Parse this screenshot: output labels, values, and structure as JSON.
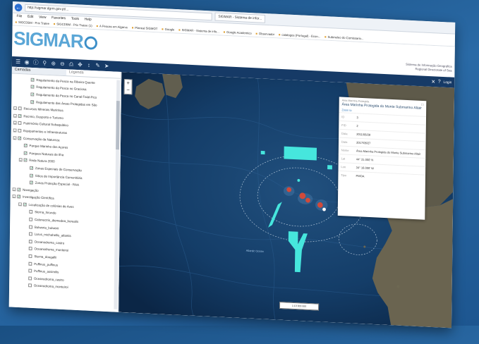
{
  "browser": {
    "url": "http://sigmar.dgrm.gov.pt/...",
    "tab_label": "SIGMAR - Sistema de infor...",
    "menu": [
      "File",
      "Edit",
      "View",
      "Favorites",
      "Tools",
      "Help"
    ],
    "favorites": [
      "SIGCDBM - Prix Tratee",
      "SIGCDBM - Prix Tratee (1)",
      "A Pescas em Algarve",
      "Planeal SIGMOT",
      "Google",
      "SIGMAR - Sistema de info...",
      "Google Academico",
      "Observador",
      "catalogos (Portugal) - Econ...",
      "Submeleo do Comissario..."
    ]
  },
  "header": {
    "logo_text": "SIGMAR",
    "subtitle_line1": "Sistema de Informação Geográfica",
    "subtitle_line2": "Regional Directorate of Sea"
  },
  "toolbar": {
    "login": "Login",
    "icons": [
      "layers-icon",
      "globe-icon",
      "info-icon",
      "search-icon",
      "zoom-in-icon",
      "zoom-out-icon",
      "print-icon",
      "pan-icon",
      "measure-icon",
      "draw-icon",
      "share-icon"
    ]
  },
  "sidebar": {
    "tabs": [
      "Camadas",
      "Legenda"
    ],
    "items": [
      {
        "label": "Regulamento da Pesca na Ribeira Quente",
        "indent": 2,
        "checked": true,
        "expandable": false
      },
      {
        "label": "Regulamento da Pesca no Graciosa",
        "indent": 2,
        "checked": true,
        "expandable": false
      },
      {
        "label": "Regulamento da Pesca no Canal Faial-Pico",
        "indent": 2,
        "checked": true,
        "expandable": false
      },
      {
        "label": "Regulamento das Áreas Protegidas em São",
        "indent": 2,
        "checked": true,
        "expandable": false
      },
      {
        "label": "Recursos Minerais Marinhos",
        "indent": 0,
        "checked": false,
        "expandable": true
      },
      {
        "label": "Recreio, Desporto e Turismo",
        "indent": 0,
        "checked": true,
        "expandable": true
      },
      {
        "label": "Património Cultural Subaquático",
        "indent": 0,
        "checked": false,
        "expandable": true
      },
      {
        "label": "Equipamentos e Infraestruturas",
        "indent": 0,
        "checked": false,
        "expandable": true
      },
      {
        "label": "Conservação da Natureza",
        "indent": 0,
        "checked": true,
        "expandable": true
      },
      {
        "label": "Parque Marinho dos Açores",
        "indent": 1,
        "checked": true,
        "expandable": false
      },
      {
        "label": "Parques Naturais de Ilha",
        "indent": 1,
        "checked": true,
        "expandable": false
      },
      {
        "label": "Rede Natura 2000",
        "indent": 1,
        "checked": true,
        "expandable": true
      },
      {
        "label": "Zonas Especiais de Conservação",
        "indent": 2,
        "checked": true,
        "expandable": false
      },
      {
        "label": "Sítios de Importância Comunitária",
        "indent": 2,
        "checked": true,
        "expandable": false
      },
      {
        "label": "Zonas Proteção Especial - RAA",
        "indent": 2,
        "checked": true,
        "expandable": false
      },
      {
        "label": "Navegação",
        "indent": 0,
        "checked": true,
        "expandable": true
      },
      {
        "label": "Investigação Científica",
        "indent": 0,
        "checked": true,
        "expandable": true
      },
      {
        "label": "Localização de colónias de Aves",
        "indent": 1,
        "checked": true,
        "expandable": true
      },
      {
        "label": "Sterna_hirundo",
        "indent": 2,
        "checked": false,
        "expandable": false
      },
      {
        "label": "Calonectris_diomedea_borealis",
        "indent": 2,
        "checked": false,
        "expandable": false
      },
      {
        "label": "Bulweria_bulwerii",
        "indent": 2,
        "checked": false,
        "expandable": false
      },
      {
        "label": "Larus_michahellis_atlantis",
        "indent": 2,
        "checked": false,
        "expandable": false
      },
      {
        "label": "Oceanodroma_castro",
        "indent": 2,
        "checked": false,
        "expandable": false
      },
      {
        "label": "Oceanodroma_monteiroi",
        "indent": 2,
        "checked": false,
        "expandable": false
      },
      {
        "label": "Sterna_dougallii",
        "indent": 2,
        "checked": false,
        "expandable": false
      },
      {
        "label": "Puffinus_puffinus",
        "indent": 2,
        "checked": false,
        "expandable": false
      },
      {
        "label": "Puffinus_assimilis",
        "indent": 2,
        "checked": false,
        "expandable": false
      },
      {
        "label": "Oceanodroma_castro",
        "indent": 2,
        "checked": false,
        "expandable": false
      },
      {
        "label": "Oceanodroma_monteiroi",
        "indent": 2,
        "checked": false,
        "expandable": false
      }
    ]
  },
  "popup": {
    "header": "Área Marinha Protegida",
    "title": "Área Marinha Protegida do Monte Submarino Altair",
    "subtitle": "Zoom to",
    "rows": [
      {
        "key": "ID",
        "value": "3"
      },
      {
        "key": "FID",
        "value": "2"
      },
      {
        "key": "Data",
        "value": "2011/06/28"
      },
      {
        "key": "Data",
        "value": "2017/06/27"
      },
      {
        "key": "Nome",
        "value": "Área Marinha Protegida do Monte Submarino Altair"
      },
      {
        "key": "Lat",
        "value": "44° 31.000' N"
      },
      {
        "key": "Lon",
        "value": "34° 16.000' W"
      },
      {
        "key": "Tipo",
        "value": "PMOA"
      }
    ]
  },
  "map": {
    "scale_text": "1:10 000 000",
    "sea_label": "Atlantic Ocean",
    "colors": {
      "sea": "#0f2f57",
      "land": "#5e5a4a",
      "zones": "#48e8e0",
      "sites": "#d14a3a"
    }
  }
}
